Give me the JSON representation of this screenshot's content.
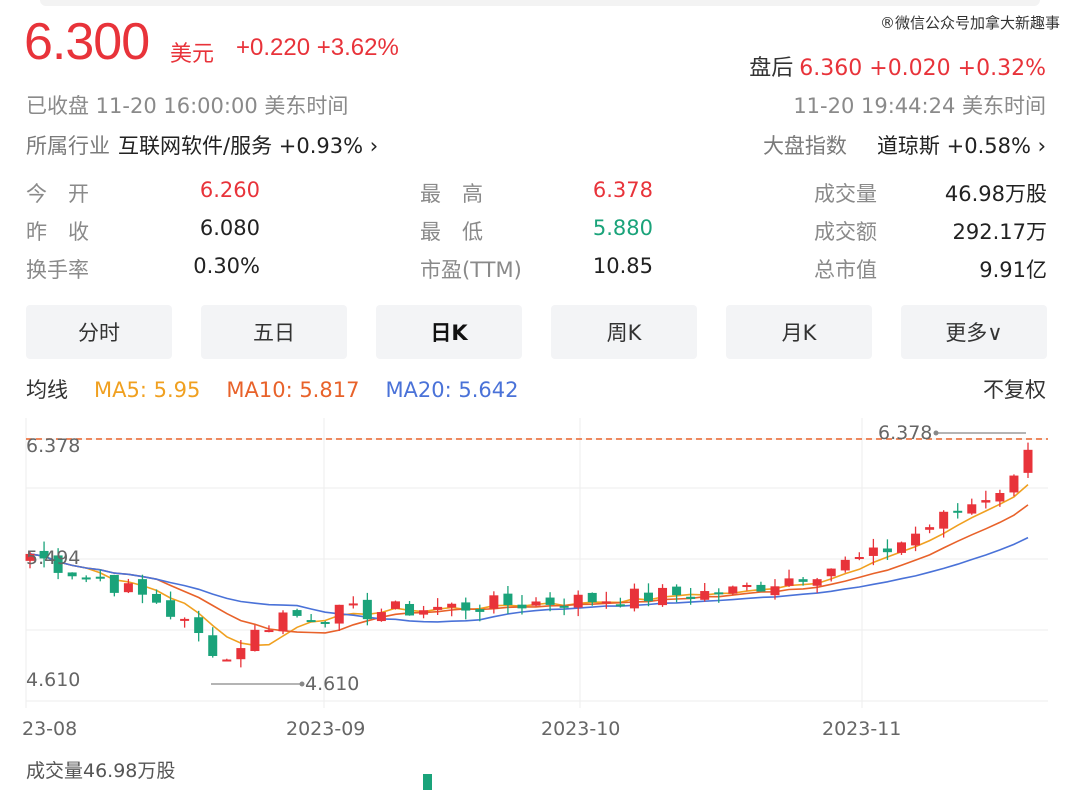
{
  "header": {
    "price": "6.300",
    "currency": "美元",
    "change": "+0.220 +3.62%",
    "watermark": "微信公众号加拿大新趣事",
    "after_hours_label": "盘后",
    "after_hours_value": "6.360 +0.020 +0.32%",
    "status": "已收盘  11-20 16:00:00  美东时间",
    "after_hours_time": "11-20 19:44:24  美东时间",
    "industry_label": "所属行业",
    "industry_value": "互联网软件/服务 +0.93% ›",
    "index_label": "大盘指数",
    "index_value": "道琼斯 +0.58% ›"
  },
  "stats": [
    {
      "label": "今　开",
      "value": "6.260",
      "color": "red"
    },
    {
      "label": "最　高",
      "value": "6.378",
      "color": "red"
    },
    {
      "label": "成交量",
      "value": "46.98万股",
      "color": "dark"
    },
    {
      "label": "昨　收",
      "value": "6.080",
      "color": "dark"
    },
    {
      "label": "最　低",
      "value": "5.880",
      "color": "green"
    },
    {
      "label": "成交额",
      "value": "292.17万",
      "color": "dark"
    },
    {
      "label": "换手率",
      "value": "0.30%",
      "color": "dark"
    },
    {
      "label": "市盈(TTM)",
      "value": "10.85",
      "color": "dark"
    },
    {
      "label": "总市值",
      "value": "9.91亿",
      "color": "dark"
    }
  ],
  "tabs": [
    "分时",
    "五日",
    "日K",
    "周K",
    "月K",
    "更多∨"
  ],
  "active_tab": 2,
  "ma": {
    "label": "均线",
    "ma5": "MA5: 5.95",
    "ma10": "MA10: 5.817",
    "ma20": "MA20: 5.642",
    "adjust": "不复权"
  },
  "colors": {
    "up": "#e8333a",
    "down": "#1aa37a",
    "ma5": "#f0a020",
    "ma10": "#e8622a",
    "ma20": "#4a72d8"
  },
  "chart_data": {
    "type": "candlestick",
    "y_labels": [
      "6.378",
      "5.494",
      "4.610"
    ],
    "x_labels": [
      "23-08",
      "2023-09",
      "2023-10",
      "2023-11"
    ],
    "max_marker": "6.378",
    "min_marker": "4.610",
    "ylim": [
      4.61,
      6.378
    ]
  },
  "volume": {
    "label": "成交量46.98万股"
  }
}
